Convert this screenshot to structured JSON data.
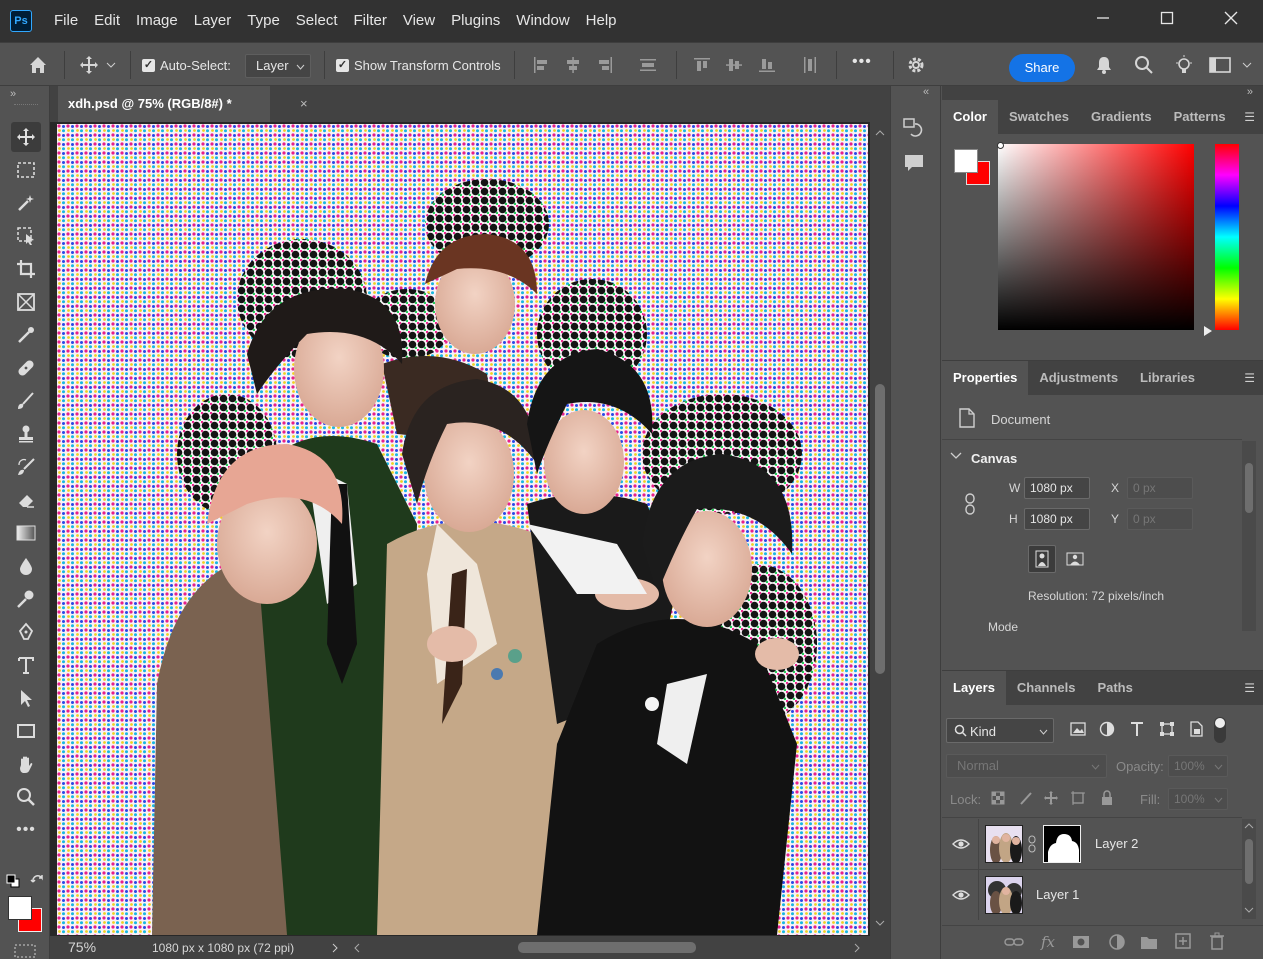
{
  "app": {
    "logo": "Ps"
  },
  "menu": [
    "File",
    "Edit",
    "Image",
    "Layer",
    "Type",
    "Select",
    "Filter",
    "View",
    "Plugins",
    "Window",
    "Help"
  ],
  "window_controls": {
    "minimize": "minimize-icon",
    "maximize": "maximize-icon",
    "close": "close-icon"
  },
  "options": {
    "auto_select_label": "Auto-Select:",
    "auto_select_value": "Layer",
    "show_transform_label": "Show Transform Controls",
    "more": "•••",
    "share_label": "Share"
  },
  "document": {
    "tab_title": "xdh.psd @ 75% (RGB/8#) *",
    "close_glyph": "×",
    "zoom": "75%",
    "info": "1080 px x 1080 px (72 ppi)"
  },
  "color_panel": {
    "tabs": [
      "Color",
      "Swatches",
      "Gradients",
      "Patterns"
    ],
    "foreground": "#ffffff",
    "background": "#ff0000",
    "hue": "#ff0000"
  },
  "properties_panel": {
    "tabs": [
      "Properties",
      "Adjustments",
      "Libraries"
    ],
    "document_label": "Document",
    "canvas_label": "Canvas",
    "w_label": "W",
    "w_value": "1080 px",
    "h_label": "H",
    "h_value": "1080 px",
    "x_label": "X",
    "x_value": "0 px",
    "y_label": "Y",
    "y_value": "0 px",
    "resolution": "Resolution: 72 pixels/inch",
    "mode_label": "Mode"
  },
  "layers_panel": {
    "tabs": [
      "Layers",
      "Channels",
      "Paths"
    ],
    "kind_label": "Kind",
    "blend_mode": "Normal",
    "opacity_label": "Opacity:",
    "opacity_value": "100%",
    "lock_label": "Lock:",
    "fill_label": "Fill:",
    "fill_value": "100%",
    "layers": [
      {
        "name": "Layer 2",
        "visible": true,
        "has_mask": true
      },
      {
        "name": "Layer 1",
        "visible": true,
        "has_mask": false
      }
    ],
    "footer_fx": "fx"
  }
}
